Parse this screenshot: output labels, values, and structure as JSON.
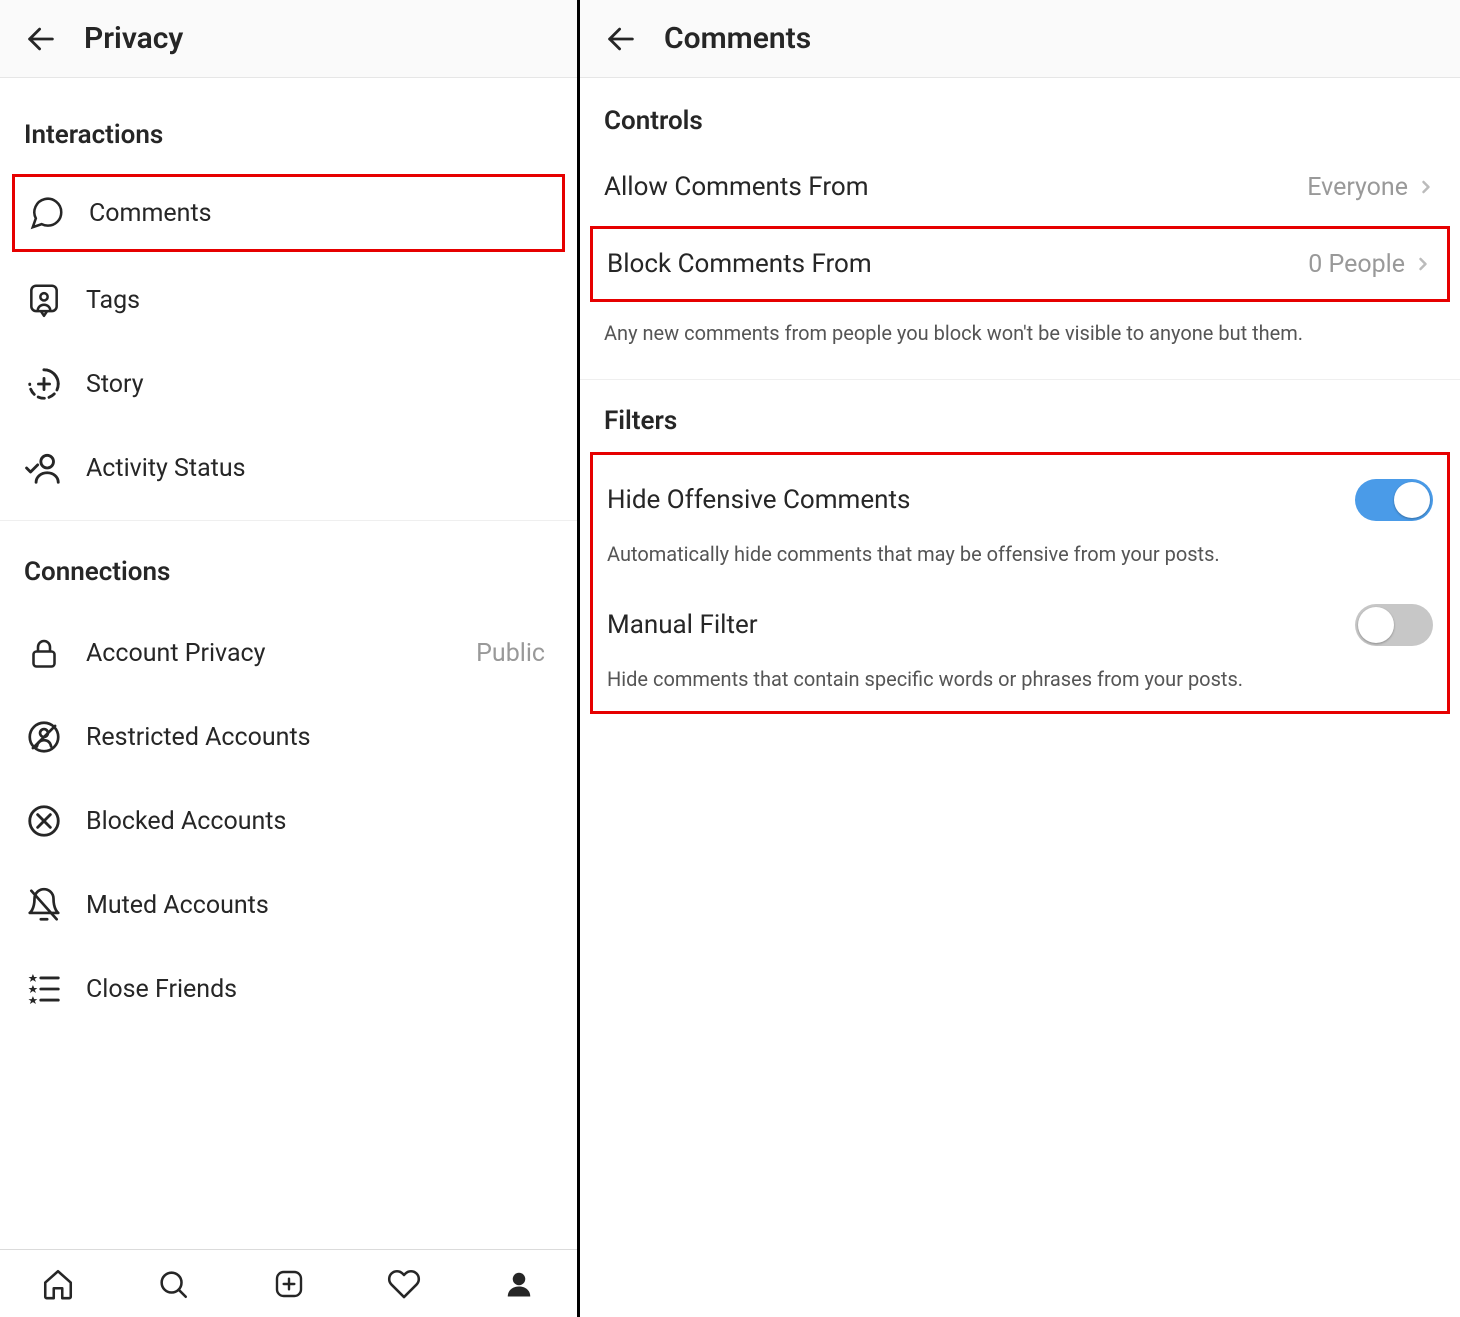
{
  "left": {
    "title": "Privacy",
    "sections": {
      "interactions": {
        "title": "Interactions",
        "items": {
          "comments": "Comments",
          "tags": "Tags",
          "story": "Story",
          "activity_status": "Activity Status"
        }
      },
      "connections": {
        "title": "Connections",
        "items": {
          "account_privacy": "Account Privacy",
          "account_privacy_value": "Public",
          "restricted": "Restricted Accounts",
          "blocked": "Blocked Accounts",
          "muted": "Muted Accounts",
          "close_friends": "Close Friends"
        }
      }
    }
  },
  "right": {
    "title": "Comments",
    "controls": {
      "title": "Controls",
      "allow_from_label": "Allow Comments From",
      "allow_from_value": "Everyone",
      "block_from_label": "Block Comments From",
      "block_from_value": "0 People",
      "block_desc": "Any new comments from people you block won't be visible to anyone but them."
    },
    "filters": {
      "title": "Filters",
      "hide_offensive_label": "Hide Offensive Comments",
      "hide_offensive_on": true,
      "hide_offensive_desc": "Automatically hide comments that may be offensive from your posts.",
      "manual_filter_label": "Manual Filter",
      "manual_filter_on": false,
      "manual_filter_desc": "Hide comments that contain specific words or phrases from your posts."
    }
  }
}
